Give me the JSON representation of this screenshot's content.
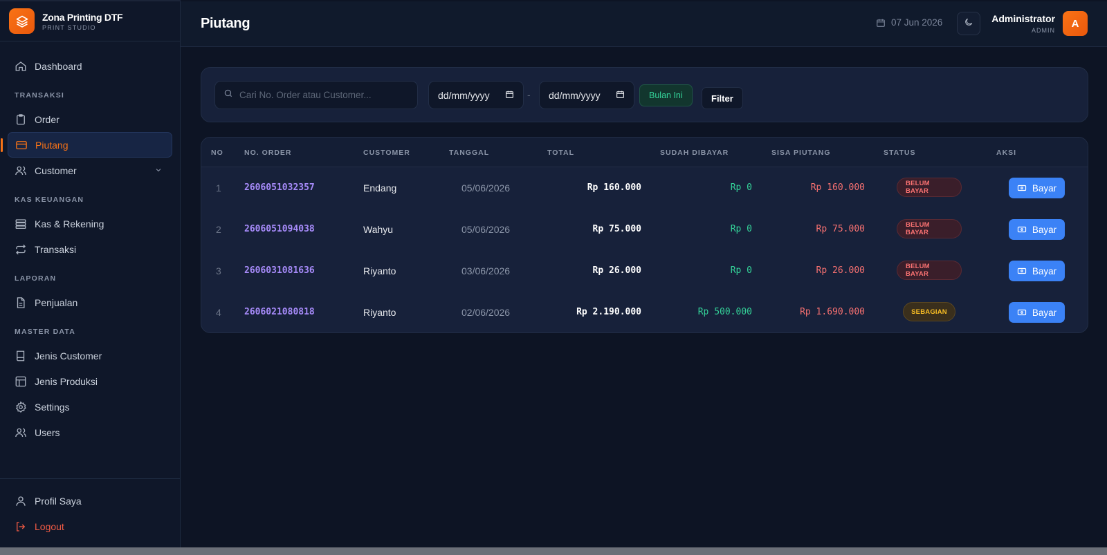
{
  "brand": {
    "name": "Zona Printing DTF",
    "subtitle": "PRINT STUDIO"
  },
  "sidebar": {
    "dashboard": "Dashboard",
    "sections": {
      "transaksi": "TRANSAKSI",
      "kas": "KAS KEUANGAN",
      "laporan": "LAPORAN",
      "master": "MASTER DATA"
    },
    "items": {
      "order": "Order",
      "piutang": "Piutang",
      "customer": "Customer",
      "kas_rekening": "Kas & Rekening",
      "transaksi": "Transaksi",
      "penjualan": "Penjualan",
      "jenis_customer": "Jenis Customer",
      "jenis_produksi": "Jenis Produksi",
      "settings": "Settings",
      "users": "Users"
    },
    "bottom": {
      "profile": "Profil Saya",
      "logout": "Logout"
    }
  },
  "header": {
    "title": "Piutang",
    "date": "07 Jun 2026",
    "user_name": "Administrator",
    "user_role": "ADMIN",
    "avatar_initial": "A"
  },
  "filter": {
    "search_placeholder": "Cari No. Order atau Customer...",
    "date_from": "dd/mm/yyyy",
    "date_to": "dd/mm/yyyy",
    "separator": "-",
    "month_chip": "Bulan Ini",
    "filter_button": "Filter"
  },
  "table": {
    "headers": {
      "no": "NO",
      "order": "NO. ORDER",
      "customer": "CUSTOMER",
      "date": "TANGGAL",
      "total": "TOTAL",
      "paid": "SUDAH DIBAYAR",
      "remaining": "SISA PIUTANG",
      "status": "STATUS",
      "action": "AKSI"
    },
    "pay_label": "Bayar",
    "rows": [
      {
        "no": "1",
        "order": "2606051032357",
        "customer": "Endang",
        "date": "05/06/2026",
        "total": "Rp 160.000",
        "paid": "Rp 0",
        "remaining": "Rp 160.000",
        "status": "BELUM BAYAR"
      },
      {
        "no": "2",
        "order": "2606051094038",
        "customer": "Wahyu",
        "date": "05/06/2026",
        "total": "Rp 75.000",
        "paid": "Rp 0",
        "remaining": "Rp 75.000",
        "status": "BELUM BAYAR"
      },
      {
        "no": "3",
        "order": "2606031081636",
        "customer": "Riyanto",
        "date": "03/06/2026",
        "total": "Rp 26.000",
        "paid": "Rp 0",
        "remaining": "Rp 26.000",
        "status": "BELUM BAYAR"
      },
      {
        "no": "4",
        "order": "2606021080818",
        "customer": "Riyanto",
        "date": "02/06/2026",
        "total": "Rp 2.190.000",
        "paid": "Rp 500.000",
        "remaining": "Rp 1.690.000",
        "status": "SEBAGIAN"
      }
    ]
  },
  "colors": {
    "accent": "#f97316",
    "primary_button": "#3b82f6",
    "paid": "#34d399",
    "remaining": "#f87171",
    "order_link": "#a78bfa",
    "partial": "#fbbf24"
  }
}
